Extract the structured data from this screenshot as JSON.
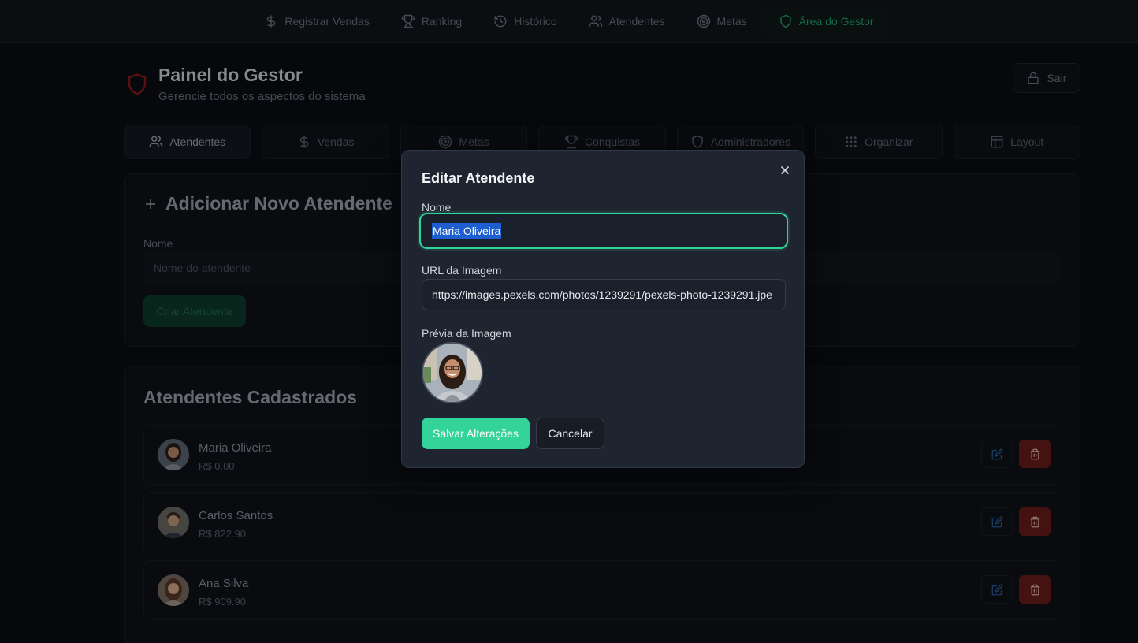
{
  "nav": {
    "items": [
      {
        "label": "Registrar Vendas",
        "icon": "dollar-icon"
      },
      {
        "label": "Ranking",
        "icon": "trophy-icon"
      },
      {
        "label": "Histórico",
        "icon": "history-icon"
      },
      {
        "label": "Atendentes",
        "icon": "users-icon"
      },
      {
        "label": "Metas",
        "icon": "target-icon"
      },
      {
        "label": "Área do Gestor",
        "icon": "shield-icon",
        "active": true
      }
    ]
  },
  "header": {
    "title": "Painel do Gestor",
    "subtitle": "Gerencie todos os aspectos do sistema",
    "logout_label": "Sair"
  },
  "tabs": [
    {
      "label": "Atendentes",
      "icon": "users-icon",
      "active": true
    },
    {
      "label": "Vendas",
      "icon": "dollar-icon"
    },
    {
      "label": "Metas",
      "icon": "target-icon"
    },
    {
      "label": "Conquistas",
      "icon": "trophy-icon"
    },
    {
      "label": "Administradores",
      "icon": "shield-icon"
    },
    {
      "label": "Organizar",
      "icon": "grid-icon"
    },
    {
      "label": "Layout",
      "icon": "layout-icon"
    }
  ],
  "add_form": {
    "title": "Adicionar Novo Atendente",
    "name_label": "Nome",
    "name_placeholder": "Nome do atendente",
    "create_label": "Criar Atendente"
  },
  "list": {
    "title": "Atendentes Cadastrados",
    "rows": [
      {
        "name": "Maria Oliveira",
        "value": "R$ 0.00"
      },
      {
        "name": "Carlos Santos",
        "value": "R$ 822.90"
      },
      {
        "name": "Ana Silva",
        "value": "R$ 909.90"
      }
    ]
  },
  "modal": {
    "title": "Editar Atendente",
    "name_label": "Nome",
    "name_value": "Maria Oliveira",
    "url_label": "URL da Imagem",
    "url_value": "https://images.pexels.com/photos/1239291/pexels-photo-1239291.jpe",
    "preview_label": "Prévia da Imagem",
    "save_label": "Salvar Alterações",
    "cancel_label": "Cancelar"
  },
  "colors": {
    "accent": "#34d399",
    "danger": "#b91c1c",
    "modal_bg": "#1e2430",
    "page_bg": "#0b0d12"
  }
}
